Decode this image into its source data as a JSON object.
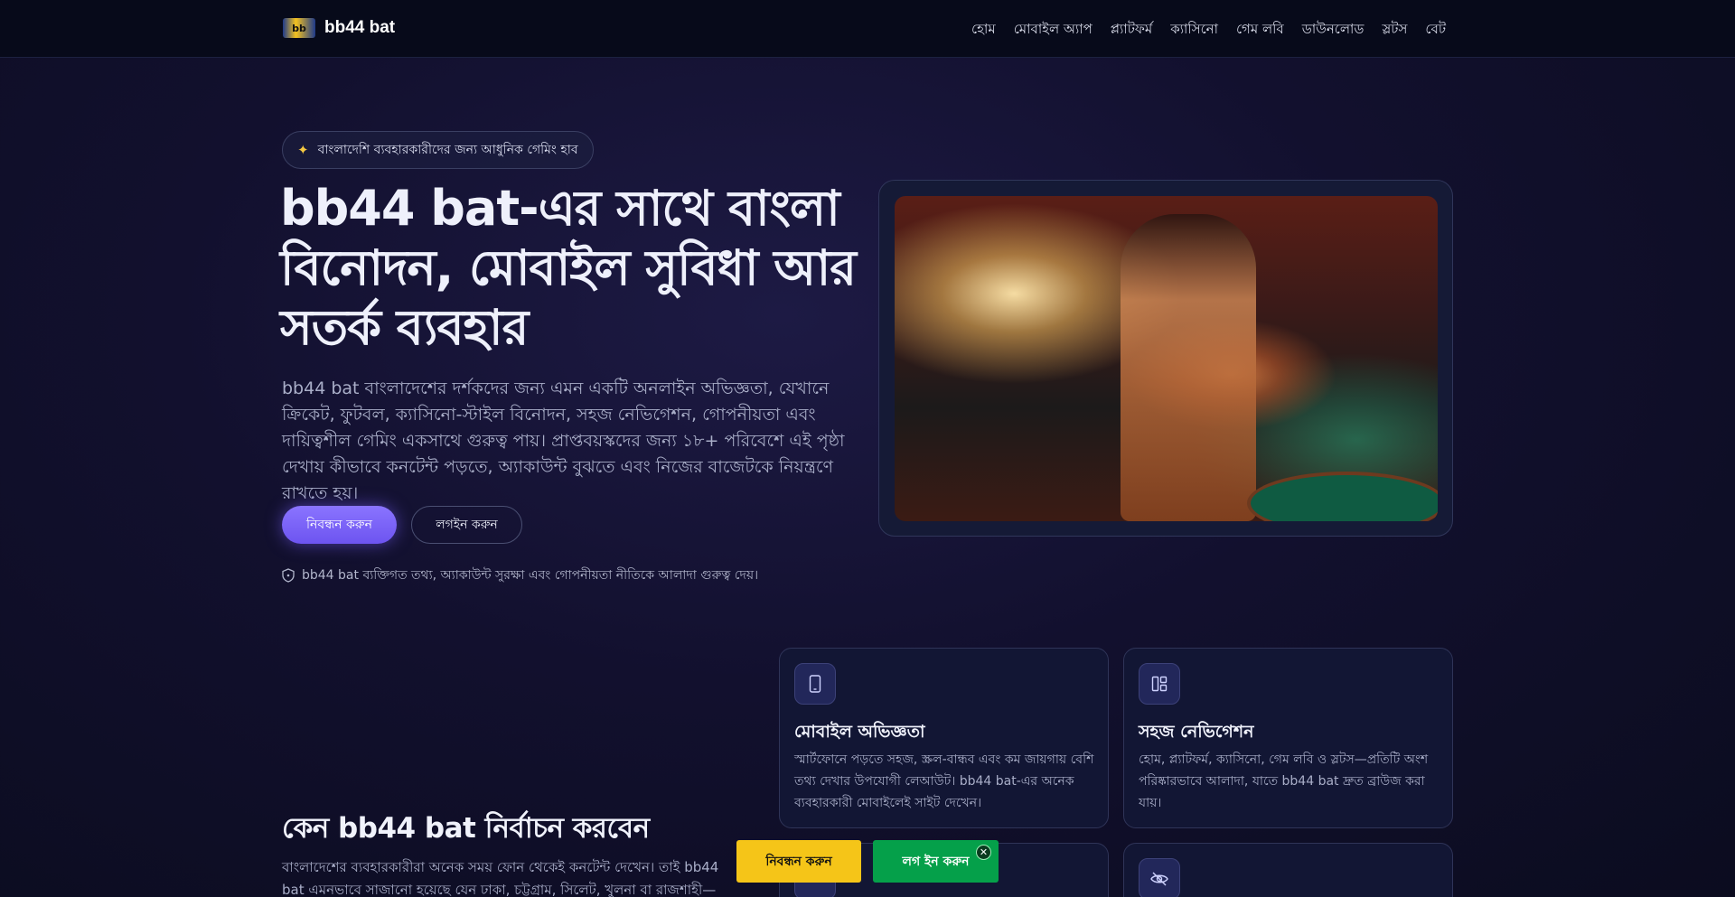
{
  "header": {
    "brand_name": "bb44 bat",
    "logo_text": "bb",
    "nav": [
      "হোম",
      "মোবাইল অ্যাপ",
      "প্ল্যাটফর্ম",
      "ক্যাসিনো",
      "গেম লবি",
      "ডাউনলোড",
      "স্লটস",
      "বেট"
    ]
  },
  "hero": {
    "badge": "বাংলাদেশি ব্যবহারকারীদের জন্য আধুনিক গেমিং হাব",
    "title": "bb44 bat-এর সাথে বাংলা বিনোদন, মোবাইল সুবিধা আর সতর্ক ব্যবহার",
    "description": "bb44 bat বাংলাদেশের দর্শকদের জন্য এমন একটি অনলাইন অভিজ্ঞতা, যেখানে ক্রিকেট, ফুটবল, ক্যাসিনো-স্টাইল বিনোদন, সহজ নেভিগেশন, গোপনীয়তা এবং দায়িত্বশীল গেমিং একসাথে গুরুত্ব পায়। প্রাপ্তবয়স্কদের জন্য ১৮+ পরিবেশে এই পৃষ্ঠা দেখায় কীভাবে কনটেন্ট পড়তে, অ্যাকাউন্ট বুঝতে এবং নিজের বাজেটকে নিয়ন্ত্রণে রাখতে হয়।",
    "register_label": "নিবন্ধন করুন",
    "login_label": "লগইন করুন",
    "privacy_note": "bb44 bat ব্যক্তিগত তথ্য, অ্যাকাউন্ট সুরক্ষা এবং গোপনীয়তা নীতিকে আলাদা গুরুত্ব দেয়।"
  },
  "why": {
    "title": "কেন bb44 bat নির্বাচন করবেন",
    "description": "বাংলাদেশের ব্যবহারকারীরা অনেক সময় ফোন থেকেই কনটেন্ট দেখেন। তাই bb44 bat এমনভাবে সাজানো হয়েছে যেন ঢাকা, চট্টগ্রাম, সিলেট, খুলনা বা রাজশাহী—যেখান থেকেই"
  },
  "features": [
    {
      "icon": "smartphone-icon",
      "title": "মোবাইল অভিজ্ঞতা",
      "text": "স্মার্টফোনে পড়তে সহজ, স্ক্রল-বান্ধব এবং কম জায়গায় বেশি তথ্য দেখার উপযোগী লেআউট। bb44 bat-এর অনেক ব্যবহারকারী মোবাইলেই সাইট দেখেন।"
    },
    {
      "icon": "layout-icon",
      "title": "সহজ নেভিগেশন",
      "text": "হোম, প্ল্যাটফর্ম, ক্যাসিনো, গেম লবি ও স্লটস—প্রতিটি অংশ পরিষ্কারভাবে আলাদা, যাতে bb44 bat দ্রুত ব্রাউজ করা যায়।"
    }
  ],
  "sticky": {
    "register_label": "নিবন্ধন করুন",
    "login_label": "লগ ইন করুন",
    "close_glyph": "✕"
  }
}
